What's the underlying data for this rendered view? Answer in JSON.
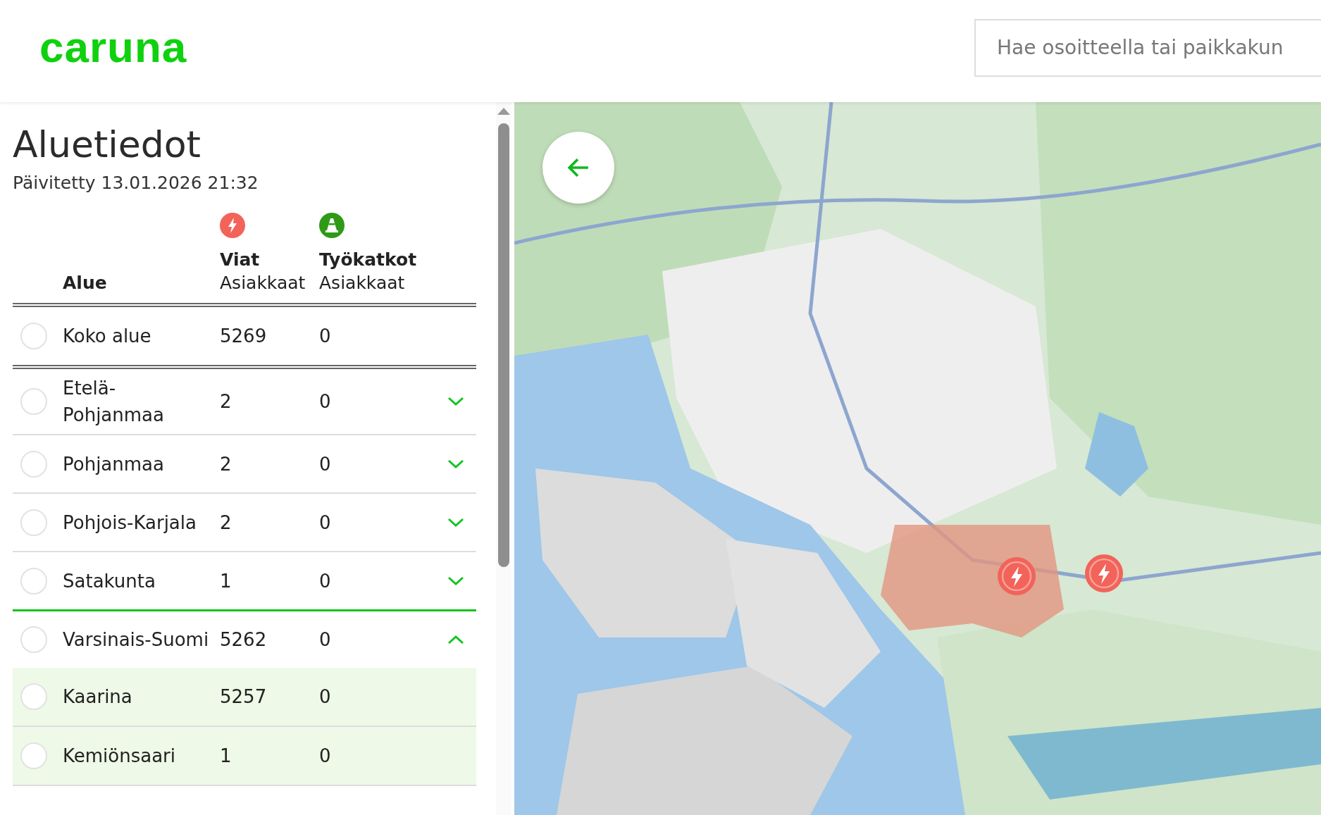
{
  "header": {
    "logo": "caruna",
    "search": {
      "placeholder": "Hae osoitteella tai paikkakun"
    }
  },
  "sidebar": {
    "title": "Aluetiedot",
    "updated": "Päivitetty 13.01.2026 21:32",
    "columns": [
      {
        "kind": "area",
        "title": "Alue"
      },
      {
        "kind": "faults",
        "title": "Viat",
        "subtitle": "Asiakkaat"
      },
      {
        "kind": "planned",
        "title": "Työkatkot",
        "subtitle": "Asiakkaat"
      }
    ],
    "rows": [
      {
        "kind": "total",
        "name": "Koko alue",
        "faults": "5269",
        "planned": "0",
        "selected": false
      },
      {
        "kind": "region",
        "name": "Etelä-Pohjanmaa",
        "faults": "2",
        "planned": "0",
        "selected": false,
        "expanded": false
      },
      {
        "kind": "region",
        "name": "Pohjanmaa",
        "faults": "2",
        "planned": "0",
        "selected": false,
        "expanded": false
      },
      {
        "kind": "region",
        "name": "Pohjois-Karjala",
        "faults": "2",
        "planned": "0",
        "selected": false,
        "expanded": false
      },
      {
        "kind": "region",
        "name": "Satakunta",
        "faults": "1",
        "planned": "0",
        "selected": false,
        "expanded": false
      },
      {
        "kind": "region",
        "name": "Varsinais-Suomi",
        "faults": "5262",
        "planned": "0",
        "selected": false,
        "expanded": true,
        "children": [
          {
            "name": "Kaarina",
            "faults": "5257",
            "planned": "0",
            "selected": false
          },
          {
            "name": "Kemiönsaari",
            "faults": "1",
            "planned": "0",
            "selected": false
          }
        ]
      }
    ]
  },
  "map": {
    "kind": "picture",
    "markers": [
      {
        "kind": "fault"
      },
      {
        "kind": "fault"
      }
    ]
  }
}
